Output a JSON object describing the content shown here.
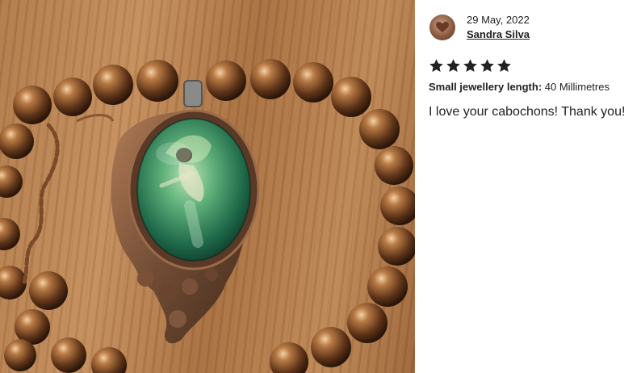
{
  "photo": {
    "subject": "pendant-photo"
  },
  "review": {
    "date": "29 May, 2022",
    "reviewer_name": "Sandra Silva",
    "rating": 5,
    "rating_max": 5,
    "variation_label": "Small jewellery length:",
    "variation_value": "40 Millimetres",
    "text": "I love your cabochons! Thank you!"
  },
  "colors": {
    "star": "#222222",
    "text": "#222222"
  }
}
